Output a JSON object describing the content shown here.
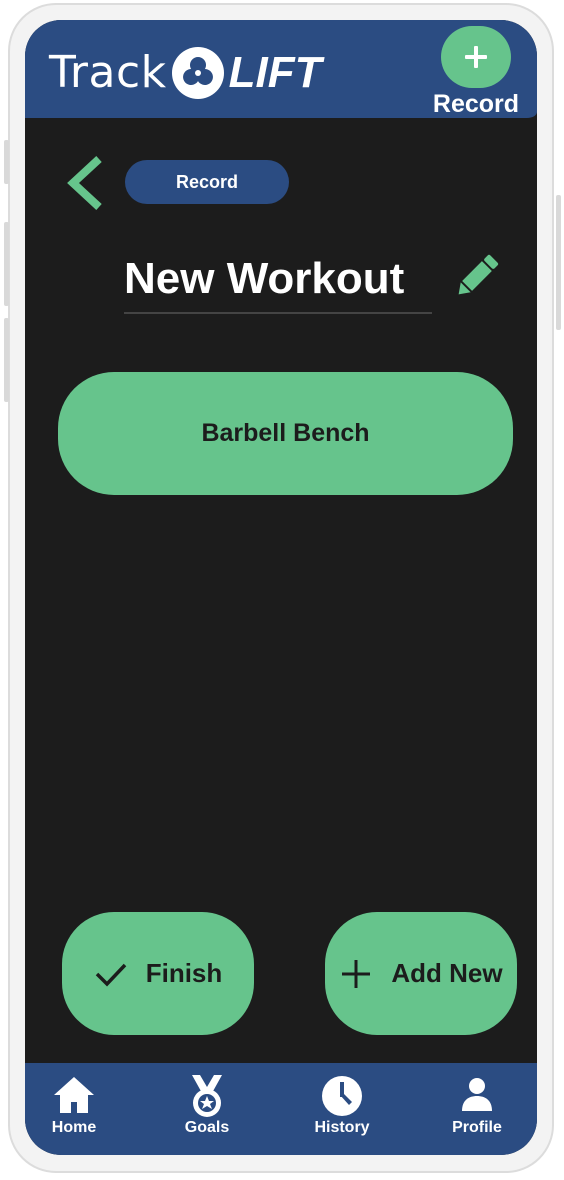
{
  "app": {
    "logo_track": "Track",
    "logo_lift": "LIFT"
  },
  "header": {
    "record_button_icon": "plus-icon",
    "record_label": "Record"
  },
  "page": {
    "back_icon": "chevron-left-icon",
    "breadcrumb": "Record",
    "title": "New Workout",
    "edit_icon": "pencil-icon"
  },
  "exercises": [
    {
      "name": "Barbell Bench"
    }
  ],
  "actions": {
    "finish_label": "Finish",
    "finish_icon": "check-icon",
    "add_new_label": "Add New",
    "add_new_icon": "plus-icon"
  },
  "nav": {
    "items": [
      {
        "label": "Home",
        "icon": "home-icon"
      },
      {
        "label": "Goals",
        "icon": "medal-icon"
      },
      {
        "label": "History",
        "icon": "clock-icon"
      },
      {
        "label": "Profile",
        "icon": "person-icon"
      }
    ]
  },
  "colors": {
    "primary_blue": "#2b4c82",
    "accent_green": "#66c48c",
    "background": "#1c1c1c"
  }
}
